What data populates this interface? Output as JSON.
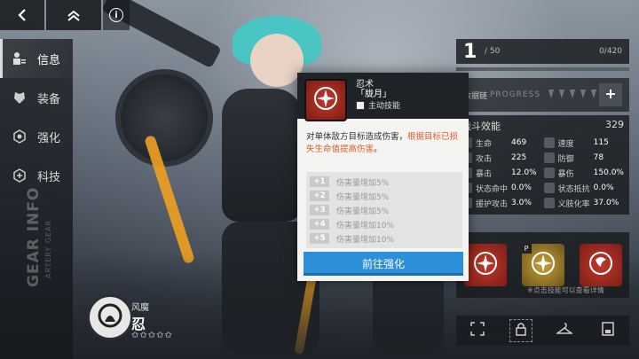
{
  "colors": {
    "accent_blue": "#2d8fd9",
    "highlight_orange": "#e35d2b",
    "ribbon_orange": "#f0a020",
    "hair_teal": "#49c6c4"
  },
  "topbar": {
    "back_icon": "chevron-left-icon",
    "home_icon": "double-chevron-up-icon",
    "info_label": "i"
  },
  "sidebar": {
    "items": [
      {
        "label": "信息",
        "icon": "user-list-icon",
        "active": true
      },
      {
        "label": "装备",
        "icon": "armor-icon",
        "active": false
      },
      {
        "label": "强化",
        "icon": "upgrade-hex-icon",
        "active": false
      },
      {
        "label": "科技",
        "icon": "tech-icon",
        "active": false
      }
    ],
    "watermark_title": "GEAR INFO",
    "watermark_sub": "ARTERY GEAR"
  },
  "character": {
    "faction": "风魔",
    "name": "忍",
    "stars": "✩✩✩✩✩"
  },
  "right_panel": {
    "level": "1",
    "exp": "/ 50",
    "exp_max": "0/420",
    "progress": 0.0,
    "chain_label": "数据链",
    "chain_label_en": "PROGRESS",
    "stats_title": "战斗效能",
    "stats_value": "329",
    "stats": [
      {
        "label": "生命",
        "value": "469"
      },
      {
        "label": "速度",
        "value": "115"
      },
      {
        "label": "攻击",
        "value": "225"
      },
      {
        "label": "防御",
        "value": "78"
      },
      {
        "label": "暴击",
        "value": "12.0%"
      },
      {
        "label": "暴伤",
        "value": "150.0%"
      },
      {
        "label": "状态命中",
        "value": "0.0%"
      },
      {
        "label": "状态抵抗",
        "value": "0.0%"
      },
      {
        "label": "援护攻击",
        "value": "3.0%"
      },
      {
        "label": "义肢化率",
        "value": "37.0%"
      }
    ],
    "skill_p_label": "P",
    "hint": "※点击技能可以查看详情"
  },
  "popup": {
    "title_line1": "忍术",
    "title_line2": "「胧月」",
    "type": "主动技能",
    "desc_normal": "对单体敌方目标造成伤害，",
    "desc_highlight": "根据目标已损失生命值提高伤害",
    "desc_end": "。",
    "upgrades": [
      {
        "num": "+1",
        "text": "伤害量增加5%"
      },
      {
        "num": "+2",
        "text": "伤害量增加5%"
      },
      {
        "num": "+3",
        "text": "伤害量增加5%"
      },
      {
        "num": "+4",
        "text": "伤害量增加10%"
      },
      {
        "num": "+5",
        "text": "伤害量增加10%"
      }
    ],
    "button_label": "前往强化"
  }
}
